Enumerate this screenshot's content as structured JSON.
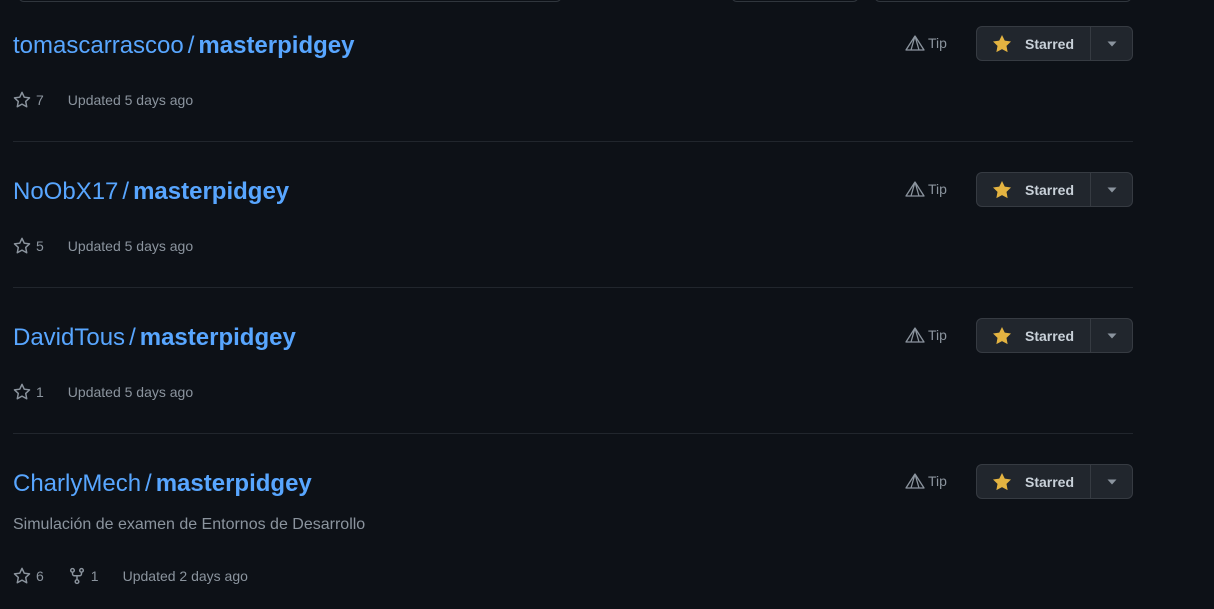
{
  "repos": [
    {
      "owner": "tomascarrascoo",
      "separator": "/",
      "name": "masterpidgey",
      "description": "",
      "stars": "7",
      "forks": "",
      "updated": "Updated 5 days ago",
      "tip_label": "Tip",
      "starred_label": "Starred"
    },
    {
      "owner": "NoObX17",
      "separator": "/",
      "name": "masterpidgey",
      "description": "",
      "stars": "5",
      "forks": "",
      "updated": "Updated 5 days ago",
      "tip_label": "Tip",
      "starred_label": "Starred"
    },
    {
      "owner": "DavidTous",
      "separator": "/",
      "name": "masterpidgey",
      "description": "",
      "stars": "1",
      "forks": "",
      "updated": "Updated 5 days ago",
      "tip_label": "Tip",
      "starred_label": "Starred"
    },
    {
      "owner": "CharlyMech",
      "separator": "/",
      "name": "masterpidgey",
      "description": "Simulación de examen de Entornos de Desarrollo",
      "stars": "6",
      "forks": "1",
      "updated": "Updated 2 days ago",
      "tip_label": "Tip",
      "starred_label": "Starred"
    }
  ],
  "icons": {
    "star_outline": "star-icon",
    "star_filled": "star-filled-icon",
    "fork": "repo-forked-icon",
    "tip": "prism-icon",
    "caret": "triangle-down-icon"
  },
  "colors": {
    "background": "#0d1117",
    "link": "#58a6ff",
    "muted": "#8b949e",
    "star_fill": "#e3b341",
    "button_bg": "#21262d",
    "border": "#30363d"
  }
}
